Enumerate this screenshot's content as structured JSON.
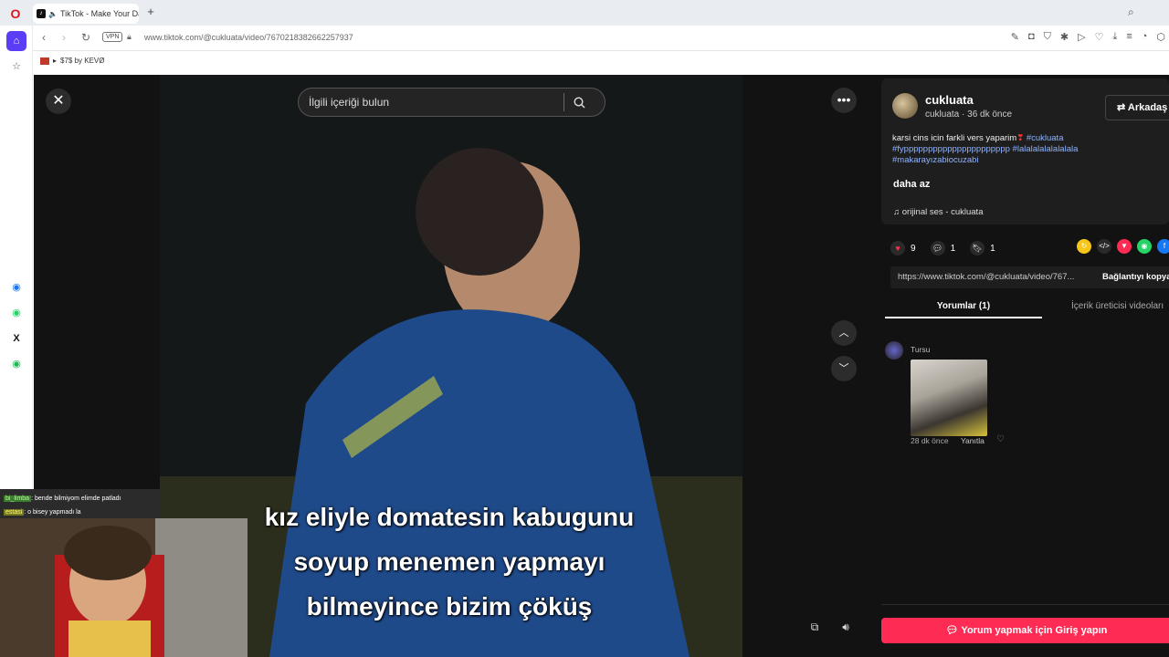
{
  "browser": {
    "tab_title": "TikTok - Make Your Day",
    "url": "www.tiktok.com/@cukluata/video/7670218382662257937",
    "vpn_label": "VPN",
    "bookmark": "$7$ by KEVØ"
  },
  "video": {
    "search_placeholder": "İlgili içeriği bulun",
    "subtitles": [
      "kız eliyle domatesin kabugunu",
      "soyup menemen yapmayı",
      "bilmeyince bizim çöküş"
    ]
  },
  "stream_chat": {
    "line1_user": "bi_limba",
    "line1_text": ": bende bilmiyom elimde patladı",
    "line2_user": "estasi",
    "line2_text": ": o bisey yapmadı la"
  },
  "panel": {
    "author_name": "cukluata",
    "author_sub": "cukluata · 36 dk önce",
    "follow_label": "Arkadaş",
    "description_text": "karsi cins icin farkli vers yaparim",
    "hashtags": "#cukluata #fypppppppppppppppppppppp #lalalalalalalalala #makarayızabiocuzabi",
    "less_label": "daha az",
    "music": "orijinal ses - cukluata",
    "likes": "9",
    "comments": "1",
    "saves": "1",
    "share_url": "https://www.tiktok.com/@cukluata/video/767...",
    "copy_label": "Bağlantıyı kopyala",
    "tab_comments": "Yorumlar (1)",
    "tab_creator": "İçerik üreticisi videoları",
    "comment_user": "Tursu",
    "comment_time": "28 dk önce",
    "comment_reply": "Yanıtla",
    "login_button": "Yorum yapmak için Giriş yapın"
  }
}
